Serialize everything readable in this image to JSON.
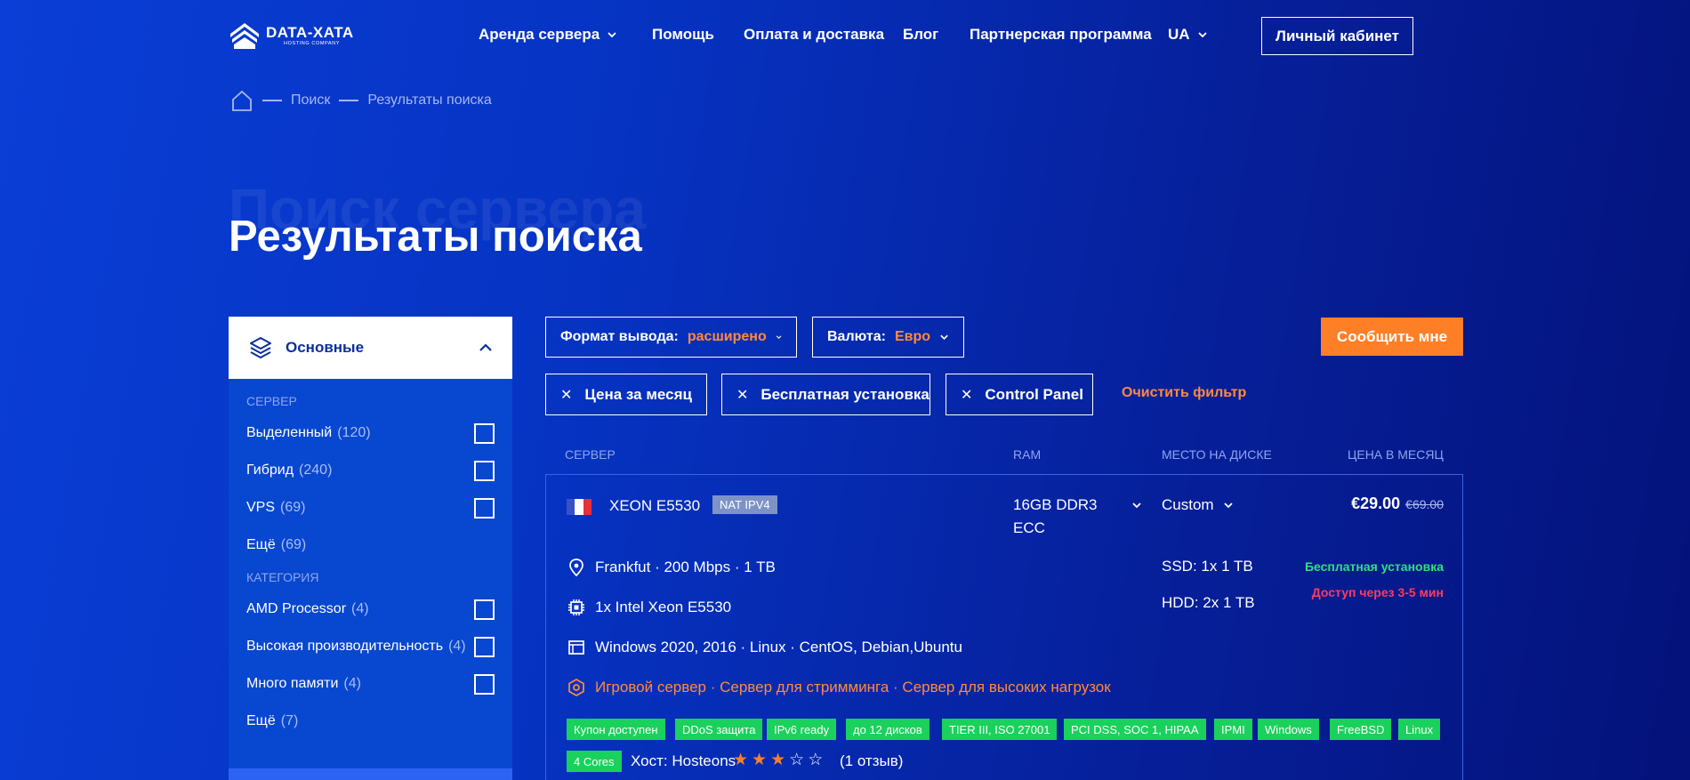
{
  "header": {
    "logo_name": "DATA-XATA",
    "logo_sub": "HOSTING COMPANY",
    "nav": [
      {
        "label": "Аренда сервера"
      },
      {
        "label": "Помощь"
      },
      {
        "label": "Оплата и доставка"
      },
      {
        "label": "Блог"
      },
      {
        "label": "Партнерская программа"
      },
      {
        "label": "UA"
      }
    ],
    "cabinet_label": "Личный кабинет"
  },
  "breadcrumb": {
    "items": [
      "Поиск",
      "Результаты поиска"
    ]
  },
  "page": {
    "ghost_title": "Поиск сервера",
    "title": "Результаты поиска"
  },
  "sidebar": {
    "header_label": "Основные",
    "section_server": "СЕРВЕР",
    "server_items": [
      {
        "label": "Выделенный",
        "count": "(120)"
      },
      {
        "label": "Гибрид",
        "count": "(240)"
      },
      {
        "label": "VPS",
        "count": "(69)"
      },
      {
        "label": "Ещё",
        "count": "(69)"
      }
    ],
    "section_category": "КАТЕГОРИЯ",
    "category_items": [
      {
        "label": "AMD Processor",
        "count": "(4)"
      },
      {
        "label": "Высокая производительность",
        "count": "(4)"
      },
      {
        "label": "Много памяти",
        "count": "(4)"
      },
      {
        "label": "Ещё",
        "count": "(7)"
      }
    ]
  },
  "filters": {
    "format_label": "Формат вывода:",
    "format_value": "расширено",
    "currency_label": "Валюта:",
    "currency_value": "Евро",
    "notify_label": "Сообщить мне",
    "chips": [
      "Цена за месяц",
      "Бесплатная установка",
      "Control Panel"
    ],
    "clear_label": "Очистить фильтр"
  },
  "table": {
    "headers": {
      "server": "СЕРВЕР",
      "ram": "RAM",
      "disk": "МЕСТО НА ДИСКЕ",
      "price": "ЦЕНА В МЕСЯЦ"
    }
  },
  "server": {
    "name": "XEON E5530",
    "tag": "NAT IPV4",
    "ram_line1": "16GB DDR3",
    "ram_line2": "ECC",
    "disk_select": "Custom",
    "price": "€29.00",
    "old_price": "€69.00",
    "location": "Frankfut · 200 Mbps · 1 TB",
    "cpu": "1x Intel Xeon E5530",
    "os": "Windows 2020, 2016 · Linux · CentOS, Debian,Ubuntu",
    "purpose": "Игровой сервер · Сервер для стримминга · Сервер для высоких нагрузок",
    "ssd": "SSD: 1x 1 TB",
    "hdd": "HDD: 2x 1 TB",
    "free_install": "Бесплатная установка",
    "access_time": "Доступ через 3-5 мин",
    "badges": [
      "Купон доступен",
      "DDoS защита",
      "IPv6 ready",
      "до 12 дисков",
      "TIER III, ISO 27001",
      "PCI DSS, SOC 1, HIPAA",
      "IPMI",
      "Windows",
      "FreeBSD",
      "Linux"
    ],
    "badge_cores": "4 Cores",
    "host_label": "Хост: Hosteons",
    "rating": 3,
    "rating_max": 5,
    "reviews": "(1 отзыв)",
    "flag_colors": [
      "#3a50c8",
      "#ffffff",
      "#e8303a"
    ]
  },
  "colors": {
    "accent_orange": "#ff7f27",
    "badge_green": "#19d15b",
    "alert_red": "#ff3b5f"
  }
}
